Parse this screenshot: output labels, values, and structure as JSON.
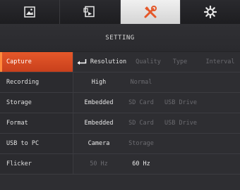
{
  "tabs": [
    {
      "icon": "image-icon",
      "active": false
    },
    {
      "icon": "video-file-icon",
      "active": false
    },
    {
      "icon": "tools-icon",
      "active": true
    },
    {
      "icon": "gear-icon",
      "active": false
    }
  ],
  "header": {
    "title": "SETTING"
  },
  "colors": {
    "accent": "#e5582a",
    "background": "#2e2e32",
    "dim_text": "#6b6b70"
  },
  "rows": [
    {
      "label": "Capture",
      "options": [
        "Resolution",
        "Quality",
        "Type",
        "Interval"
      ],
      "selected": true,
      "enter_icon": "enter-icon"
    },
    {
      "label": "Recording",
      "options": [
        "High",
        "Normal"
      ]
    },
    {
      "label": "Storage",
      "options": [
        "Embedded",
        "SD Card",
        "USB Drive"
      ]
    },
    {
      "label": "Format",
      "options": [
        "Embedded",
        "SD Card",
        "USB Drive"
      ]
    },
    {
      "label": "USB to PC",
      "options": [
        "Camera",
        "Storage"
      ]
    },
    {
      "label": "Flicker",
      "options": [
        "50 Hz",
        "60 Hz"
      ]
    }
  ]
}
